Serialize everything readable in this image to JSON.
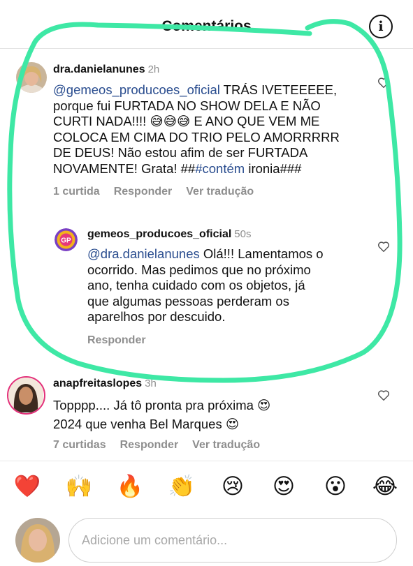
{
  "header": {
    "title": "Comentários",
    "info_icon": "info-icon"
  },
  "comments": [
    {
      "username": "dra.danielanunes",
      "time": "2h",
      "mention": "@gemeos_producoes_oficial",
      "text_lines": [
        " TRÁS IVETEEEEE,",
        "porque fui FURTADA NO SHOW DELA E NÃO",
        "CURTI NADA!!!! 😅😅😅 E ANO QUE VEM ME",
        "COLOCA EM CIMA DO TRIO PELO AMORRRRR",
        "DE DEUS! Não estou afim de ser FURTADA",
        "NOVAMENTE! Grata! ##"
      ],
      "hashtag": "#contém",
      "tail": " ironia###",
      "likes": "1 curtida",
      "reply": "Responder",
      "translate": "Ver tradução"
    },
    {
      "username": "gemeos_producoes_oficial",
      "time": "50s",
      "mention": "@dra.danielanunes",
      "text_lines": [
        " Olá!!! Lamentamos o",
        "ocorrido. Mas pedimos que no próximo",
        "ano, tenha cuidado com os objetos, já",
        "que algumas pessoas perderam os",
        "aparelhos  por descuido."
      ],
      "reply": "Responder"
    },
    {
      "username": "anapfreitaslopes",
      "time": "3h",
      "text_lines": [
        "Topppp.... Já tô pronta pra próxima 😍",
        "2024 que venha Bel Marques 😍"
      ],
      "likes": "7 curtidas",
      "reply": "Responder",
      "translate": "Ver tradução"
    }
  ],
  "reactions": [
    "❤️",
    "🙌",
    "🔥",
    "👏",
    "😢",
    "😍",
    "😮",
    "😂"
  ],
  "composer": {
    "placeholder": "Adicione um comentário..."
  },
  "colors": {
    "annotation": "#3ee8a5",
    "link": "#2a4d8f",
    "muted": "#8e8e8e"
  }
}
